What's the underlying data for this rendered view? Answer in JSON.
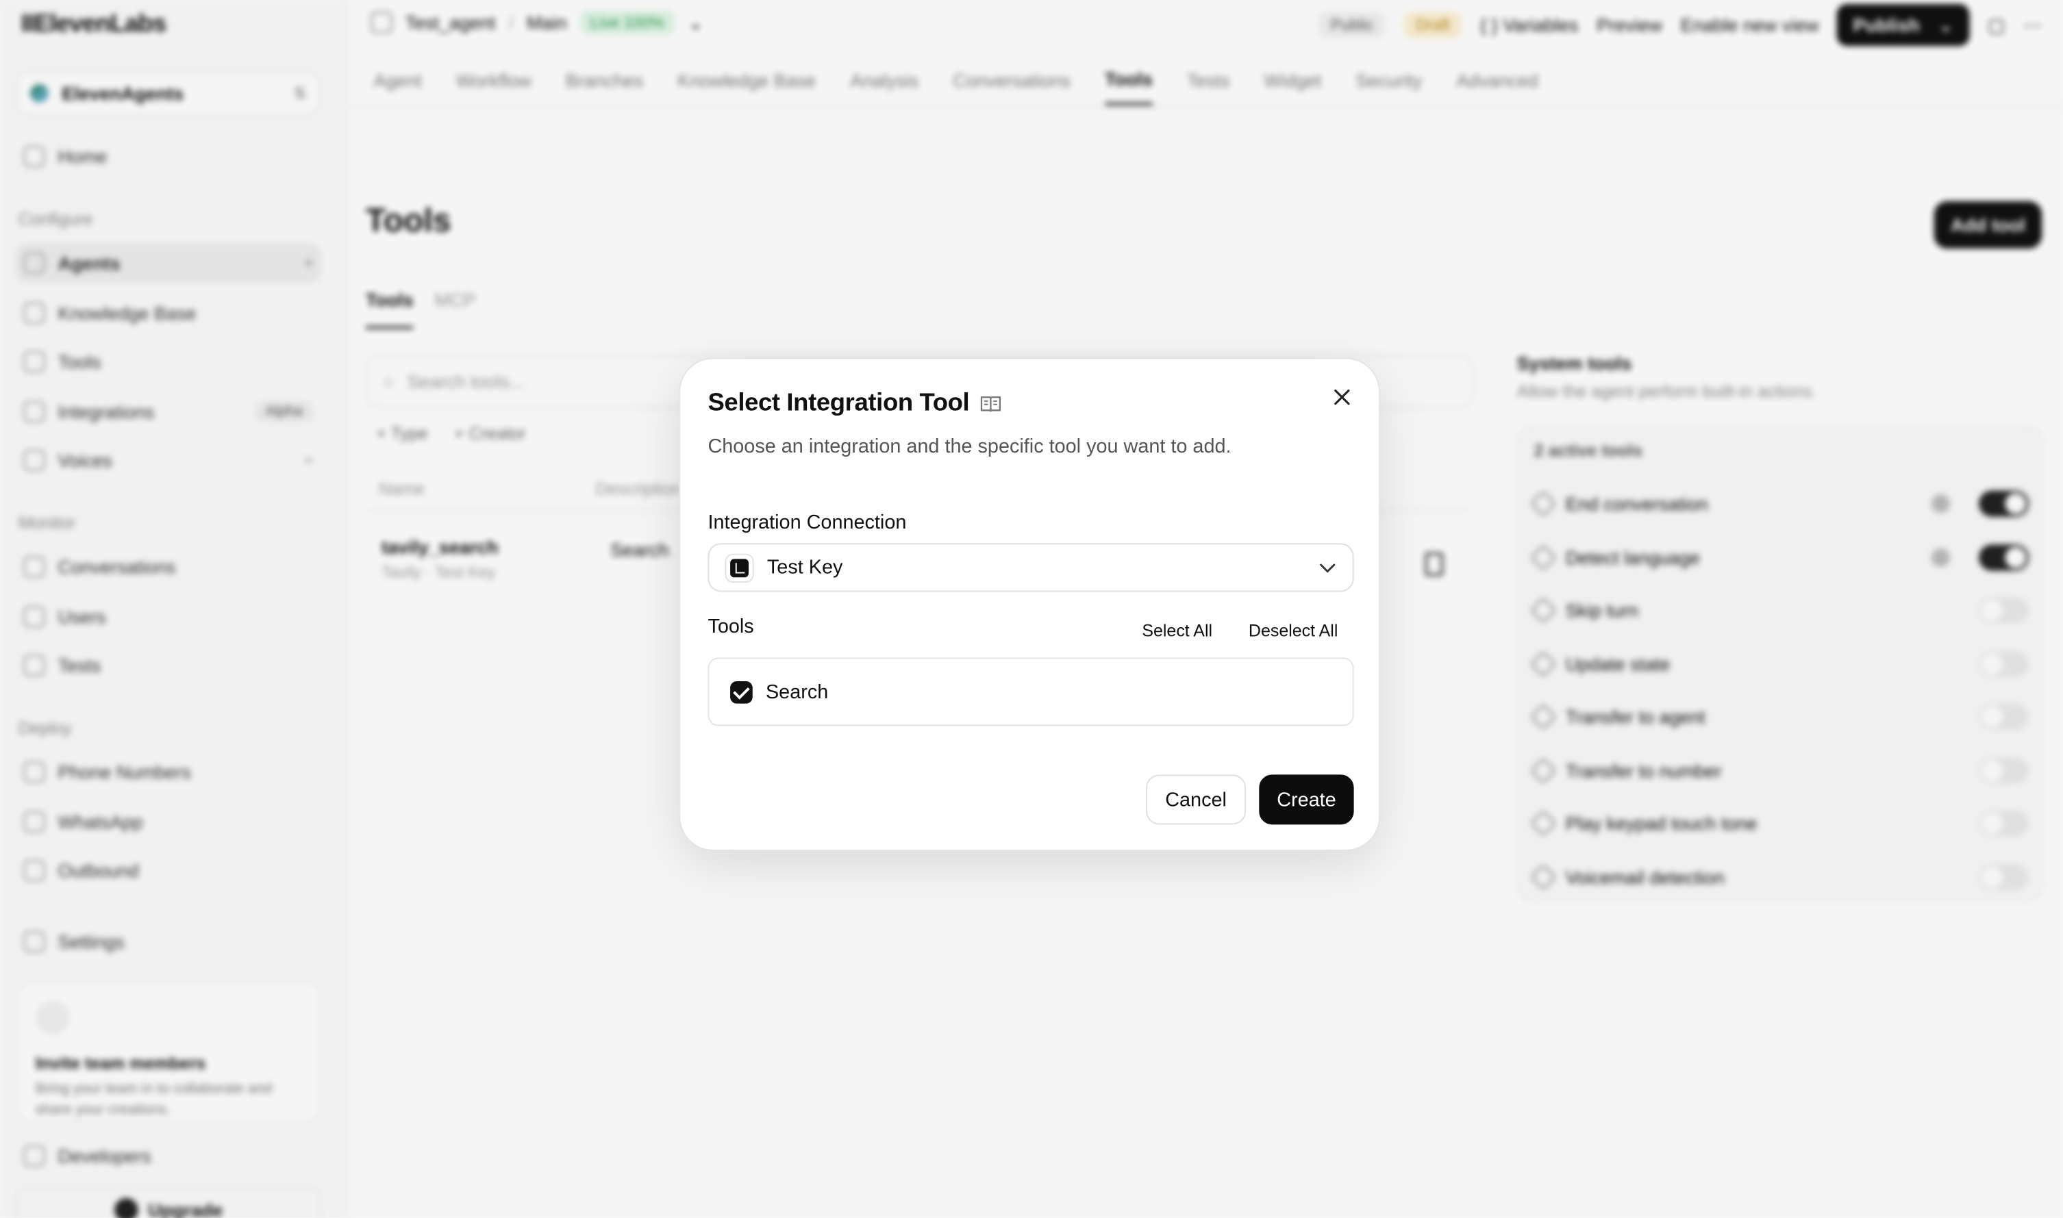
{
  "app": {
    "logo": "IIElevenLabs",
    "workspace": "ElevenAgents",
    "nav": {
      "home": "Home",
      "configure_head": "Configure",
      "agents": "Agents",
      "knowledge_base": "Knowledge Base",
      "tools": "Tools",
      "integrations": "Integrations",
      "integrations_badge": "Alpha",
      "voices": "Voices",
      "monitor_head": "Monitor",
      "conversations": "Conversations",
      "users": "Users",
      "tests": "Tests",
      "deploy_head": "Deploy",
      "phone_numbers": "Phone Numbers",
      "whatsapp": "WhatsApp",
      "outbound": "Outbound",
      "settings": "Settings",
      "developers": "Developers",
      "upgrade": "Upgrade"
    },
    "invite": {
      "title": "Invite team members",
      "desc": "Bring your team in to collaborate and share your creations."
    }
  },
  "topbar": {
    "agent": "Test_agent",
    "separator": "/",
    "branch": "Main",
    "live": "Live 100%",
    "public": "Public",
    "draft": "Draft",
    "variables": "{ } Variables",
    "preview": "Preview",
    "enable_view": "Enable new view",
    "publish": "Publish"
  },
  "tabs": [
    "Agent",
    "Workflow",
    "Branches",
    "Knowledge Base",
    "Analysis",
    "Conversations",
    "Tools",
    "Tests",
    "Widget",
    "Security",
    "Advanced"
  ],
  "active_tab": "Tools",
  "tools_page": {
    "title": "Tools",
    "add_tool": "Add tool",
    "subtab_tools": "Tools",
    "subtab_mcp": "MCP",
    "search_placeholder": "Search tools...",
    "filter_type": "+ Type",
    "filter_creator": "+ Creator",
    "col_name": "Name",
    "col_desc": "Description",
    "row_name": "tavily_search",
    "row_sub": "Tavily · Test Key",
    "row_desc": "Search ... with tit..."
  },
  "system_tools": {
    "title": "System tools",
    "desc": "Allow the agent perform built-in actions.",
    "active_count": "2 active tools",
    "items": [
      {
        "label": "End conversation",
        "on": true
      },
      {
        "label": "Detect language",
        "on": true
      },
      {
        "label": "Skip turn",
        "on": false
      },
      {
        "label": "Update state",
        "on": false
      },
      {
        "label": "Transfer to agent",
        "on": false
      },
      {
        "label": "Transfer to number",
        "on": false
      },
      {
        "label": "Play keypad touch tone",
        "on": false
      },
      {
        "label": "Voicemail detection",
        "on": false
      }
    ]
  },
  "modal": {
    "title": "Select Integration Tool",
    "description": "Choose an integration and the specific tool you want to add.",
    "connection_label": "Integration Connection",
    "connection_value": "Test Key",
    "tools_label": "Tools",
    "select_all": "Select All",
    "deselect_all": "Deselect All",
    "tool_item": "Search",
    "tool_checked": true,
    "cancel": "Cancel",
    "create": "Create"
  }
}
